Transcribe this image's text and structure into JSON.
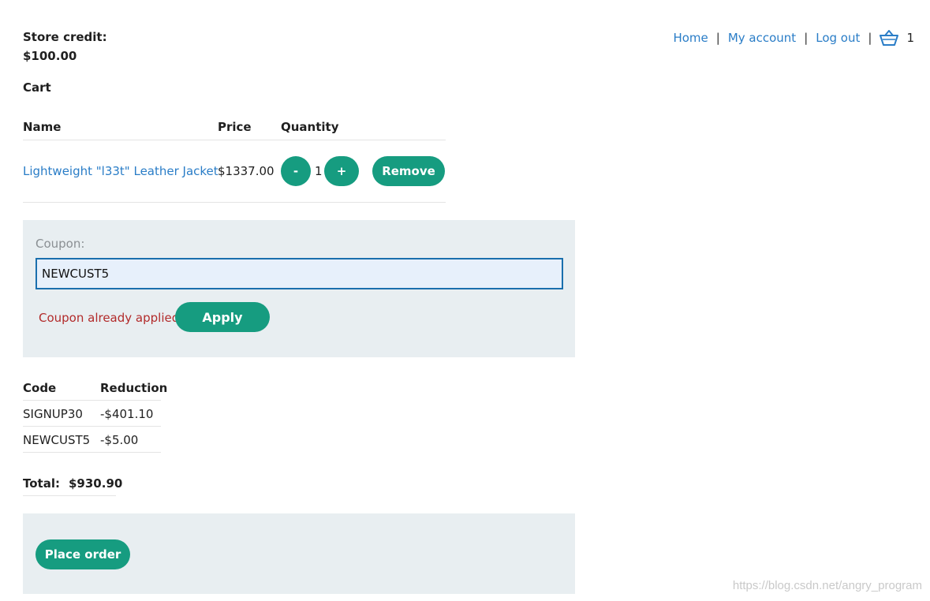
{
  "nav": {
    "home": "Home",
    "separator": "|",
    "account": "My account",
    "logout": "Log out",
    "cart_icon": "basket-icon",
    "cart_count": "1"
  },
  "store_credit": {
    "label": "Store credit:",
    "value": "$100.00"
  },
  "cart": {
    "title": "Cart",
    "columns": [
      "Name",
      "Price",
      "Quantity"
    ],
    "items": [
      {
        "name": "Lightweight \"l33t\" Leather Jacket",
        "price": "$1337.00",
        "decrement": "-",
        "quantity": "1",
        "increment": "+",
        "remove": "Remove"
      }
    ]
  },
  "coupon": {
    "label": "Coupon:",
    "value": "NEWCUST5",
    "error": "Coupon already applied",
    "apply": "Apply"
  },
  "discounts": {
    "columns": [
      "Code",
      "Reduction"
    ],
    "rows": [
      {
        "code": "SIGNUP30",
        "reduction": "-$401.10"
      },
      {
        "code": "NEWCUST5",
        "reduction": "-$5.00"
      }
    ]
  },
  "total": {
    "label": "Total:",
    "value": "$930.90"
  },
  "order": {
    "button": "Place order"
  },
  "watermark": "https://blog.csdn.net/angry_program",
  "colors": {
    "accent": "#169c80",
    "link": "#2a7dc7",
    "error": "#b22b2b",
    "panel": "#e8eef1"
  }
}
